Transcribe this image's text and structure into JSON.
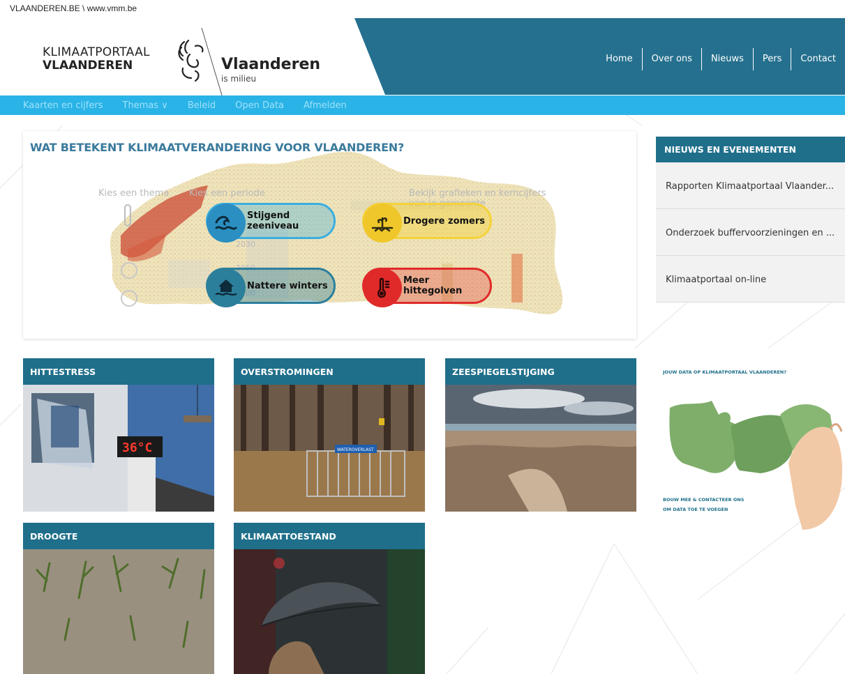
{
  "topbar": {
    "breadcrumb": "VLAANDEREN.BE \\ www.vmm.be"
  },
  "logo": {
    "line1": "KLIMAATPORTAAL",
    "line2": "VLAANDEREN",
    "vl_name": "Vlaanderen",
    "vl_tagline": "is milieu"
  },
  "topnav": {
    "items": [
      "Home",
      "Over ons",
      "Nieuws",
      "Pers",
      "Contact"
    ]
  },
  "subnav": {
    "items": [
      "Kaarten en cijfers",
      "Themas ∨",
      "Beleid",
      "Open Data",
      "Afmelden"
    ]
  },
  "map": {
    "title": "WAT BETEKENT KLIMAATVERANDERING VOOR VLAANDEREN?",
    "ghost_theme": "Kies een thema",
    "ghost_period": "Kies een periode",
    "ghost_graphs_1": "Bekijk grafieken en kerncijfers",
    "ghost_graphs_2": "van je gemeente",
    "ghost_y1": "2030",
    "ghost_y2": "2050",
    "ghost_y3": "2100",
    "pills": [
      {
        "label": "Stijgend zeeniveau",
        "icon": "waves-icon"
      },
      {
        "label": "Drogere zomers",
        "icon": "drought-icon"
      },
      {
        "label": "Nattere winters",
        "icon": "flood-house-icon"
      },
      {
        "label": "Meer hittegolven",
        "icon": "thermometer-icon"
      }
    ],
    "colors": {
      "blue": "#3aaee0",
      "yellow": "#f4d23a",
      "teal": "#2c7f9b",
      "red": "#e02a2a"
    }
  },
  "news": {
    "heading": "NIEUWS EN EVENEMENTEN",
    "items": [
      "Rapporten Klimaatportaal Vlaander...",
      "Onderzoek buffervoorzieningen en ...",
      "Klimaatportaal on-line"
    ]
  },
  "tiles": [
    {
      "title": "HITTESTRESS",
      "display_reading": "36°C"
    },
    {
      "title": "OVERSTROMINGEN",
      "sign_text": "WATEROVERLAST"
    },
    {
      "title": "ZEESPIEGELSTIJGING"
    },
    {
      "title": "DROOGTE"
    },
    {
      "title": "KLIMAATTOESTAND"
    }
  ],
  "promo": {
    "top": "JOUW DATA OP KLIMAATPORTAAL VLAANDEREN?",
    "bottom1": "BOUW MEE & CONTACTEER ONS",
    "bottom2": "OM DATA TOE TE VOEGEN"
  },
  "theme": {
    "header_blue": "#25708e",
    "subnav_blue": "#2ab3e6",
    "tile_head": "#1f6f8b"
  }
}
